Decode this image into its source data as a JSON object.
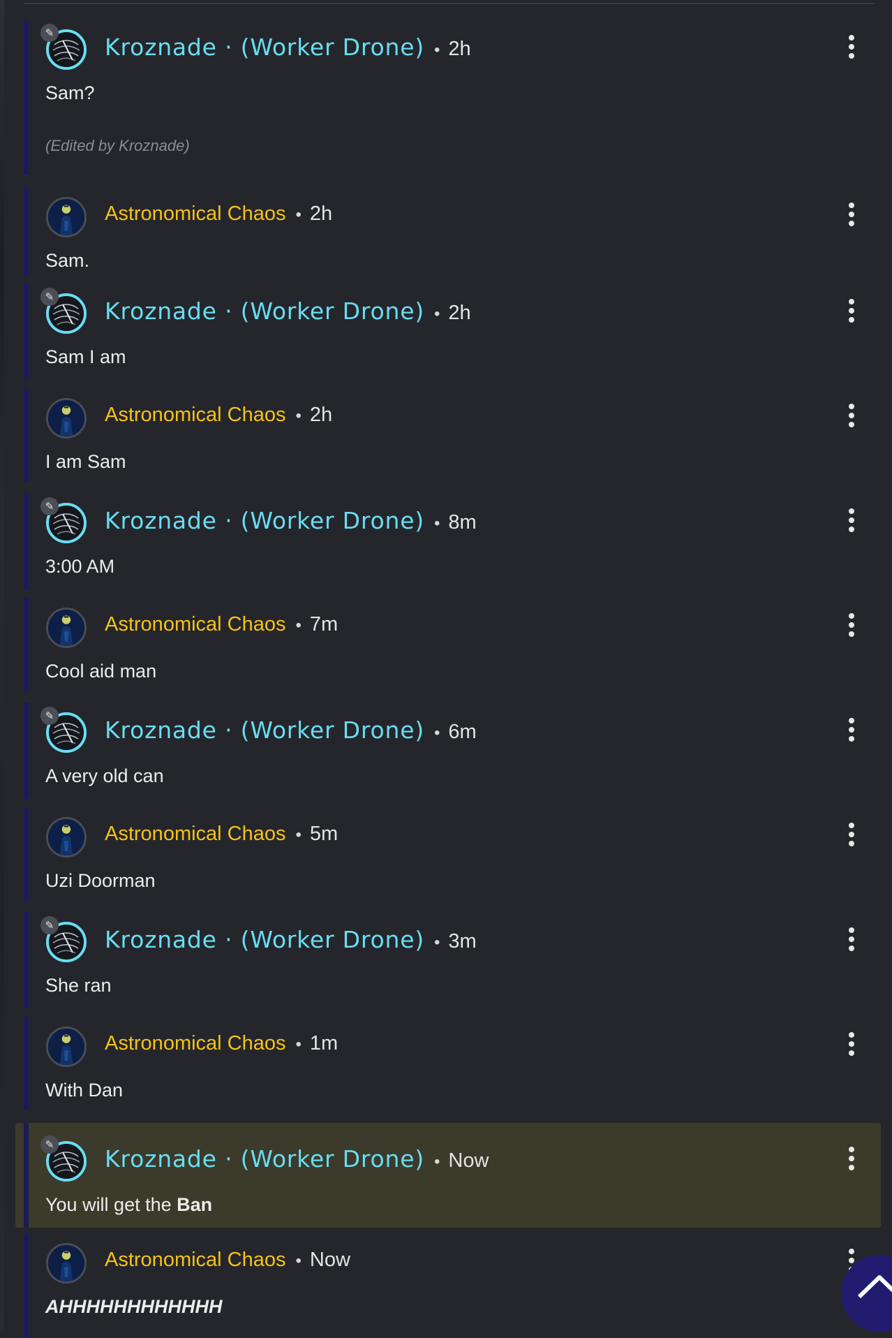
{
  "comments": [
    {
      "author": "Kroznade · (Worker Drone)",
      "user": "k",
      "time": "2h",
      "body": "Sam?",
      "edited": "(Edited by Kroznade)"
    },
    {
      "author": "Astronomical Chaos",
      "user": "a",
      "time": "2h",
      "body": "Sam."
    },
    {
      "author": "Kroznade · (Worker Drone)",
      "user": "k",
      "time": "2h",
      "body": "Sam I am"
    },
    {
      "author": "Astronomical Chaos",
      "user": "a",
      "time": "2h",
      "body": "I am Sam"
    },
    {
      "author": "Kroznade · (Worker Drone)",
      "user": "k",
      "time": "8m",
      "body": "3:00 AM"
    },
    {
      "author": "Astronomical Chaos",
      "user": "a",
      "time": "7m",
      "body": "Cool aid man"
    },
    {
      "author": "Kroznade · (Worker Drone)",
      "user": "k",
      "time": "6m",
      "body": "A very old can"
    },
    {
      "author": "Astronomical Chaos",
      "user": "a",
      "time": "5m",
      "body": "Uzi Doorman"
    },
    {
      "author": "Kroznade · (Worker Drone)",
      "user": "k",
      "time": "3m",
      "body": "She ran"
    },
    {
      "author": "Astronomical Chaos",
      "user": "a",
      "time": "1m",
      "body": "With Dan"
    },
    {
      "author": "Kroznade · (Worker Drone)",
      "user": "k",
      "time": "Now",
      "body_prefix": "You will get the ",
      "body_bold": "Ban",
      "highlighted": true
    },
    {
      "author": "Astronomical Chaos",
      "user": "a",
      "time": "Now",
      "body": "AHHHHHHHHHHHH",
      "body_style": "bold-italic"
    }
  ],
  "separator": "•",
  "icons": {
    "edit_badge": "pencil-icon",
    "menu": "more-vertical-icon",
    "scroll_top": "chevron-up-icon"
  },
  "colors": {
    "background": "#25262b",
    "kroznade_name": "#68ddf2",
    "astronomical_name": "#f4c21a",
    "thread_bar": "#1c1a5a",
    "highlight": "#3c3a2a",
    "scroll_button": "#211c70"
  }
}
